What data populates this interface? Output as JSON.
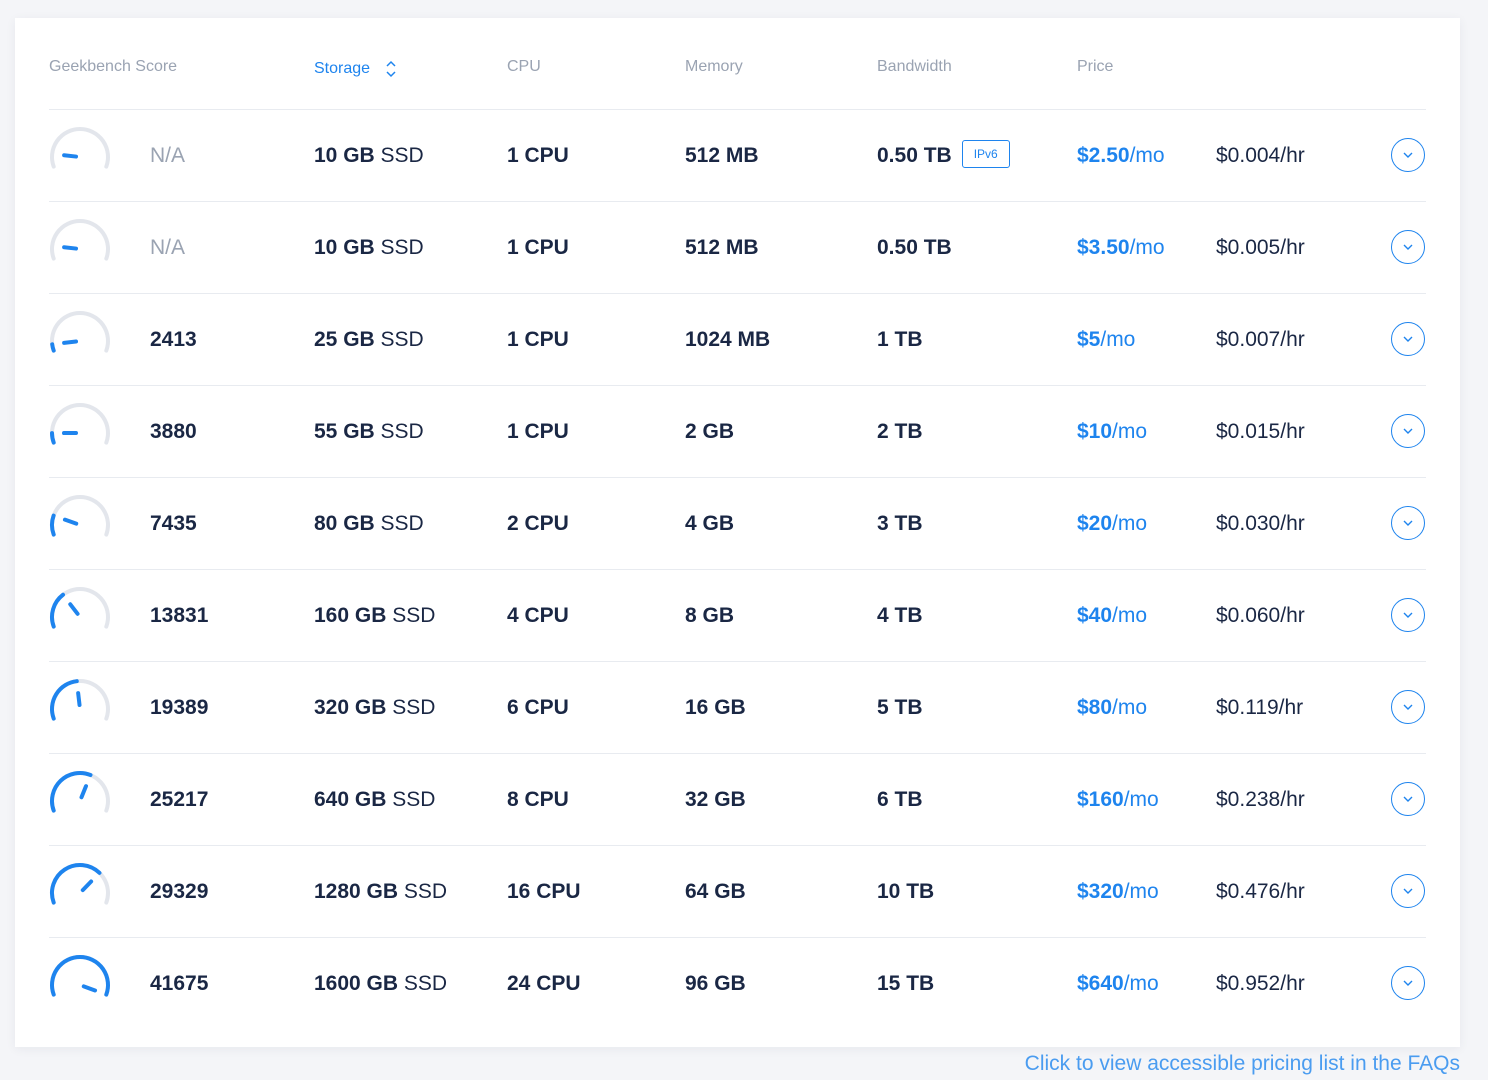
{
  "header": {
    "geekbench": "Geekbench Score",
    "storage": "Storage",
    "cpu": "CPU",
    "memory": "Memory",
    "bandwidth": "Bandwidth",
    "price": "Price"
  },
  "colors": {
    "accent": "#1e84ee",
    "muted": "#9aa3b2",
    "text": "#1a2744",
    "gauge_track": "#e3e6ec"
  },
  "icons": {
    "sort": "sort-up-down-icon",
    "expand": "chevron-down-icon",
    "gauge": "speedometer-gauge-icon"
  },
  "rows": [
    {
      "score": "N/A",
      "level": 0.12,
      "storage_num": "10 GB",
      "storage_unit": "SSD",
      "cpu": "1 CPU",
      "memory": "512 MB",
      "bandwidth": "0.50 TB",
      "badge": "IPv6",
      "price_amount": "$2.50",
      "price_unit": "/mo",
      "hourly": "$0.004/hr"
    },
    {
      "score": "N/A",
      "level": 0.12,
      "storage_num": "10 GB",
      "storage_unit": "SSD",
      "cpu": "1 CPU",
      "memory": "512 MB",
      "bandwidth": "0.50 TB",
      "badge": "",
      "price_amount": "$3.50",
      "price_unit": "/mo",
      "hourly": "$0.005/hr"
    },
    {
      "score": "2413",
      "level": 0.06,
      "storage_num": "25 GB",
      "storage_unit": "SSD",
      "cpu": "1 CPU",
      "memory": "1024 MB",
      "bandwidth": "1 TB",
      "badge": "",
      "price_amount": "$5",
      "price_unit": "/mo",
      "hourly": "$0.007/hr"
    },
    {
      "score": "3880",
      "level": 0.09,
      "storage_num": "55 GB",
      "storage_unit": "SSD",
      "cpu": "1 CPU",
      "memory": "2 GB",
      "bandwidth": "2 TB",
      "badge": "",
      "price_amount": "$10",
      "price_unit": "/mo",
      "hourly": "$0.015/hr"
    },
    {
      "score": "7435",
      "level": 0.18,
      "storage_num": "80 GB",
      "storage_unit": "SSD",
      "cpu": "2 CPU",
      "memory": "4 GB",
      "bandwidth": "3 TB",
      "badge": "",
      "price_amount": "$20",
      "price_unit": "/mo",
      "hourly": "$0.030/hr"
    },
    {
      "score": "13831",
      "level": 0.33,
      "storage_num": "160 GB",
      "storage_unit": "SSD",
      "cpu": "4 CPU",
      "memory": "8 GB",
      "bandwidth": "4 TB",
      "badge": "",
      "price_amount": "$40",
      "price_unit": "/mo",
      "hourly": "$0.060/hr"
    },
    {
      "score": "19389",
      "level": 0.47,
      "storage_num": "320 GB",
      "storage_unit": "SSD",
      "cpu": "6 CPU",
      "memory": "16 GB",
      "bandwidth": "5 TB",
      "badge": "",
      "price_amount": "$80",
      "price_unit": "/mo",
      "hourly": "$0.119/hr"
    },
    {
      "score": "25217",
      "level": 0.6,
      "storage_num": "640 GB",
      "storage_unit": "SSD",
      "cpu": "8 CPU",
      "memory": "32 GB",
      "bandwidth": "6 TB",
      "badge": "",
      "price_amount": "$160",
      "price_unit": "/mo",
      "hourly": "$0.238/hr"
    },
    {
      "score": "29329",
      "level": 0.7,
      "storage_num": "1280 GB",
      "storage_unit": "SSD",
      "cpu": "16 CPU",
      "memory": "64 GB",
      "bandwidth": "10 TB",
      "badge": "",
      "price_amount": "$320",
      "price_unit": "/mo",
      "hourly": "$0.476/hr"
    },
    {
      "score": "41675",
      "level": 1.0,
      "storage_num": "1600 GB",
      "storage_unit": "SSD",
      "cpu": "24 CPU",
      "memory": "96 GB",
      "bandwidth": "15 TB",
      "badge": "",
      "price_amount": "$640",
      "price_unit": "/mo",
      "hourly": "$0.952/hr"
    }
  ],
  "footer": {
    "link": "Click to view accessible pricing list in the FAQs"
  }
}
